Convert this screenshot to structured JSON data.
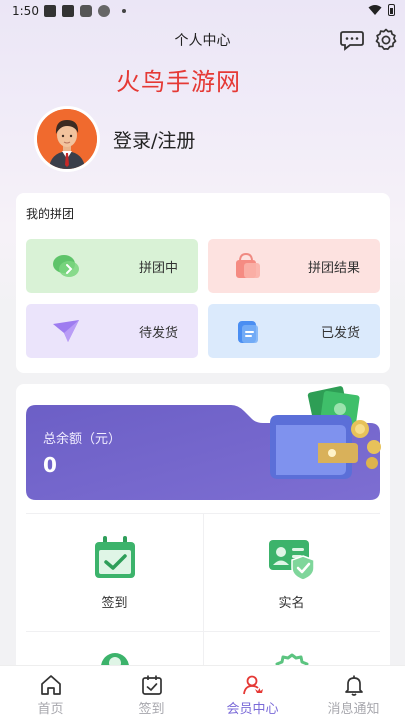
{
  "status_bar": {
    "time": "1:50"
  },
  "header": {
    "title": "个人中心"
  },
  "watermark": "火鸟手游网",
  "profile": {
    "login_label": "登录/注册"
  },
  "group_buy": {
    "title": "我的拼团",
    "tiles": [
      {
        "label": "拼团中",
        "color": "#d9f2d6"
      },
      {
        "label": "拼团结果",
        "color": "#fde2e0"
      },
      {
        "label": "待发货",
        "color": "#ebe4fb"
      },
      {
        "label": "已发货",
        "color": "#dbeafc"
      }
    ]
  },
  "balance": {
    "label": "总余额（元）",
    "amount": "0",
    "gradient": [
      "#6c5fc6",
      "#7d6ed2"
    ]
  },
  "services": [
    {
      "label": "签到",
      "icon": "calendar-check-icon"
    },
    {
      "label": "实名",
      "icon": "id-card-shield-icon"
    }
  ],
  "tabbar": {
    "items": [
      {
        "label": "首页",
        "icon": "home-icon"
      },
      {
        "label": "签到",
        "icon": "calendar-check-icon"
      },
      {
        "label": "会员中心",
        "icon": "member-icon",
        "active": true
      },
      {
        "label": "消息通知",
        "icon": "bell-icon"
      }
    ],
    "active_color": "#7a6ad8",
    "inactive_color": "#a7a7ad"
  }
}
